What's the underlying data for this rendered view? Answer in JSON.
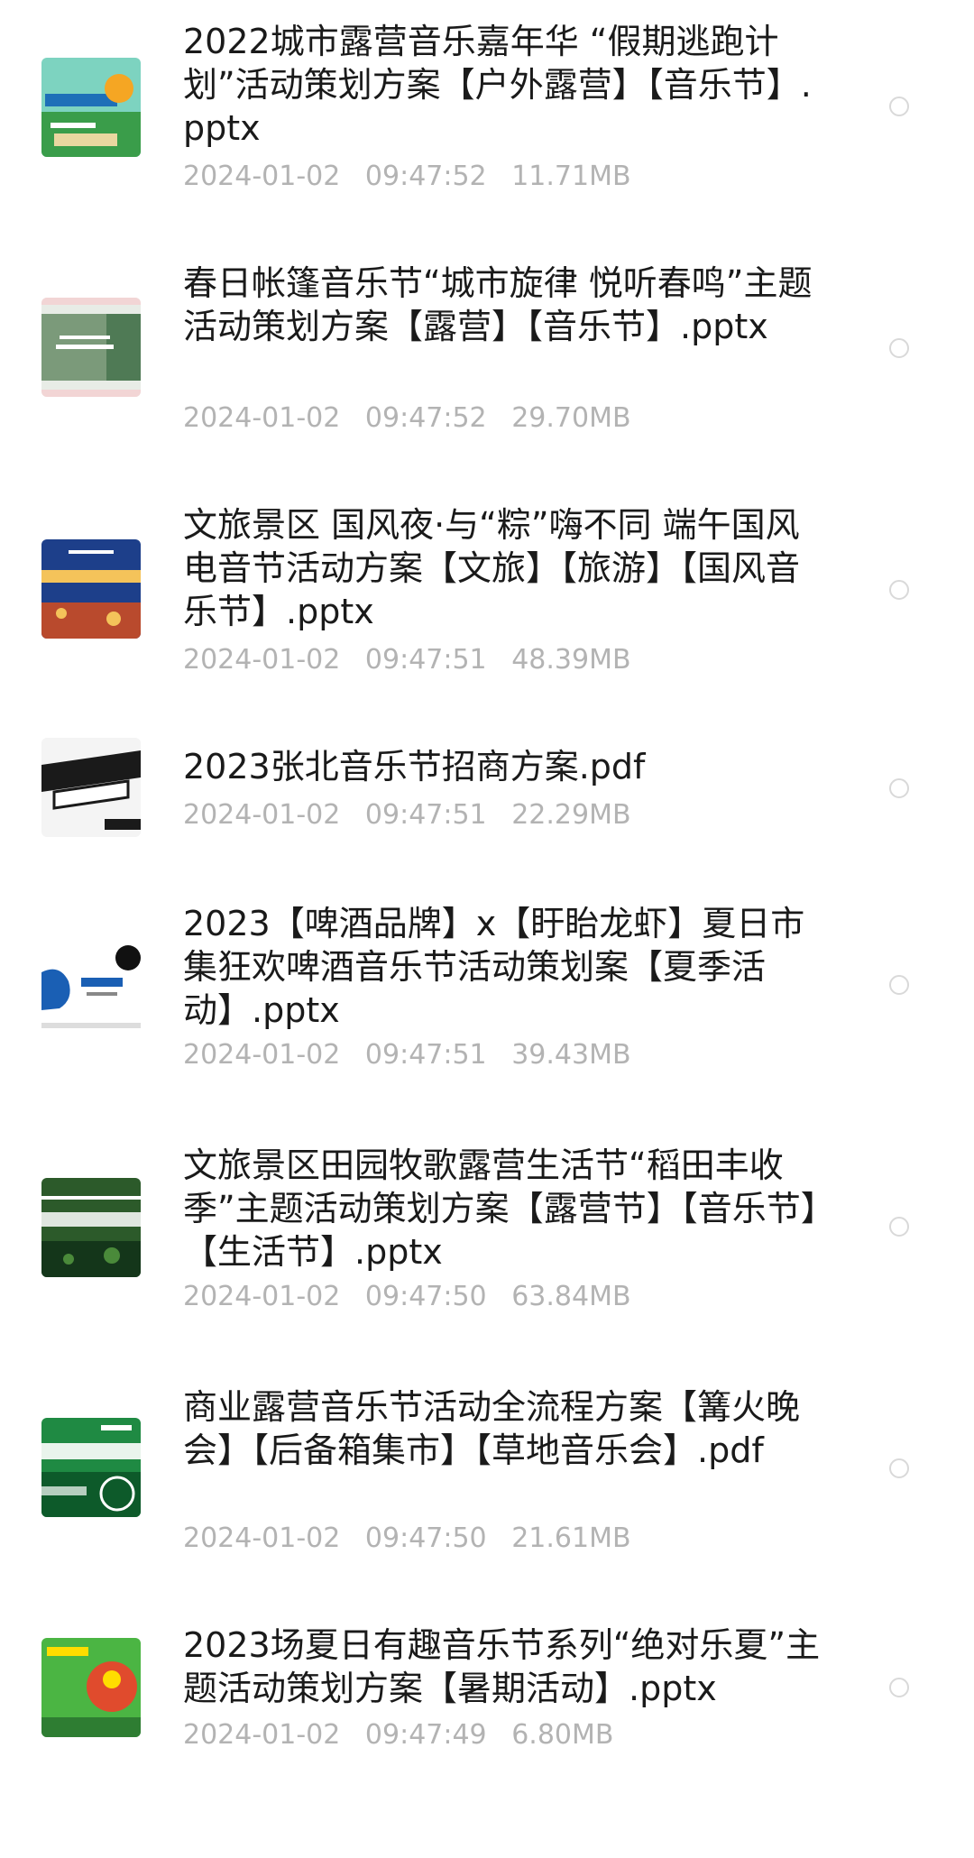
{
  "files": [
    {
      "name": "2022城市露营音乐嘉年华 “假期逃跑计划”活动策划方案【户外露营】【音乐节】.pptx",
      "date": "2024-01-02",
      "time": "09:47:52",
      "size": "11.71MB",
      "thumb_icon": "pptx-thumbnail"
    },
    {
      "name": "春日帐篷音乐节“城市旋律 悦听春鸣”主题活动策划方案【露营】【音乐节】.pptx",
      "date": "2024-01-02",
      "time": "09:47:52",
      "size": "29.70MB",
      "thumb_icon": "pptx-thumbnail"
    },
    {
      "name": "文旅景区 国风夜·与“粽”嗨不同 端午国风电音节活动方案【文旅】【旅游】【国风音乐节】.pptx",
      "date": "2024-01-02",
      "time": "09:47:51",
      "size": "48.39MB",
      "thumb_icon": "pptx-thumbnail"
    },
    {
      "name": "2023张北音乐节招商方案.pdf",
      "date": "2024-01-02",
      "time": "09:47:51",
      "size": "22.29MB",
      "thumb_icon": "pdf-thumbnail"
    },
    {
      "name": "2023【啤酒品牌】x【盱眙龙虾】夏日市集狂欢啤酒音乐节活动策划案【夏季活动】.pptx",
      "date": "2024-01-02",
      "time": "09:47:51",
      "size": "39.43MB",
      "thumb_icon": "pptx-thumbnail"
    },
    {
      "name": "文旅景区田园牧歌露营生活节“稻田丰收季”主题活动策划方案【露营节】【音乐节】【生活节】.pptx",
      "date": "2024-01-02",
      "time": "09:47:50",
      "size": "63.84MB",
      "thumb_icon": "pptx-thumbnail"
    },
    {
      "name": "商业露营音乐节活动全流程方案【篝火晚会】【后备箱集市】【草地音乐会】.pdf",
      "date": "2024-01-02",
      "time": "09:47:50",
      "size": "21.61MB",
      "thumb_icon": "pdf-thumbnail"
    },
    {
      "name": "2023场夏日有趣音乐节系列“绝对乐夏”主题活动策划方案【暑期活动】.pptx",
      "date": "2024-01-02",
      "time": "09:47:49",
      "size": "6.80MB",
      "thumb_icon": "pptx-thumbnail"
    }
  ],
  "thumbnails": [
    {
      "top_color": "#7dd3c0",
      "bottom_color": "#3a9d4a",
      "accent": "#f5a623"
    },
    {
      "top_color": "#e8ece6",
      "bottom_color": "#4f7a55",
      "accent": "#d96b6b"
    },
    {
      "top_color": "#1d3f8a",
      "bottom_color": "#b94a2d",
      "accent": "#f4c35a"
    },
    {
      "top_color": "#f4f4f4",
      "bottom_color": "#1a1a1a",
      "accent": "#ffffff"
    },
    {
      "top_color": "#ffffff",
      "bottom_color": "#1a5fb4",
      "accent": "#111111"
    },
    {
      "top_color": "#2c5a2a",
      "bottom_color": "#14361a",
      "accent": "#ffffff"
    },
    {
      "top_color": "#1f8a43",
      "bottom_color": "#0d5a2a",
      "accent": "#ffffff"
    },
    {
      "top_color": "#4bb543",
      "bottom_color": "#e04b2d",
      "accent": "#ffdd00"
    }
  ]
}
